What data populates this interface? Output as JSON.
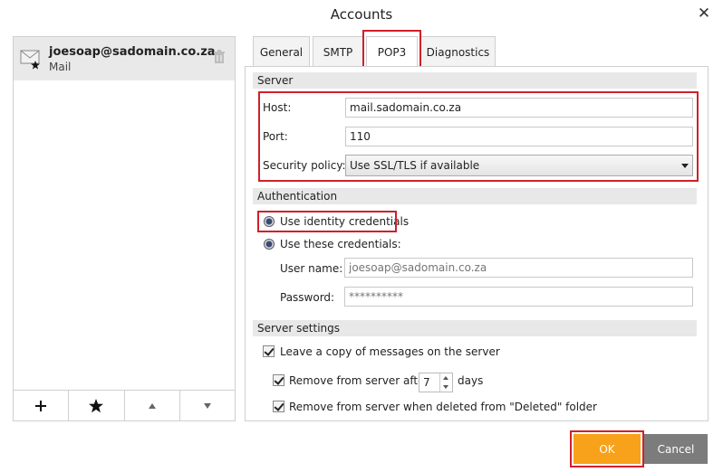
{
  "dialog": {
    "title": "Accounts"
  },
  "account": {
    "email": "joesoap@sadomain.co.za",
    "type": "Mail"
  },
  "tabs": [
    {
      "label": "General"
    },
    {
      "label": "SMTP"
    },
    {
      "label": "POP3",
      "active": true
    },
    {
      "label": "Diagnostics"
    }
  ],
  "server": {
    "section_title": "Server",
    "host_label": "Host:",
    "host_value": "mail.sadomain.co.za",
    "port_label": "Port:",
    "port_value": "110",
    "security_label": "Security policy:",
    "security_value": "Use SSL/TLS if available"
  },
  "auth": {
    "section_title": "Authentication",
    "identity_label": "Use identity credentials",
    "these_label": "Use these credentials:",
    "username_label": "User name:",
    "username_placeholder": "joesoap@sadomain.co.za",
    "password_label": "Password:",
    "password_placeholder": "**********"
  },
  "settings": {
    "section_title": "Server settings",
    "leave_copy_label": "Leave a copy of messages on the server",
    "remove_after_label": "Remove from server after",
    "remove_after_days": "7",
    "days_label": "days",
    "remove_deleted_label": "Remove from server when deleted from \"Deleted\" folder"
  },
  "buttons": {
    "ok": "OK",
    "cancel": "Cancel"
  },
  "colors": {
    "highlight": "#d0202a",
    "ok": "#f7a21a",
    "cancel": "#7c7c7c"
  }
}
